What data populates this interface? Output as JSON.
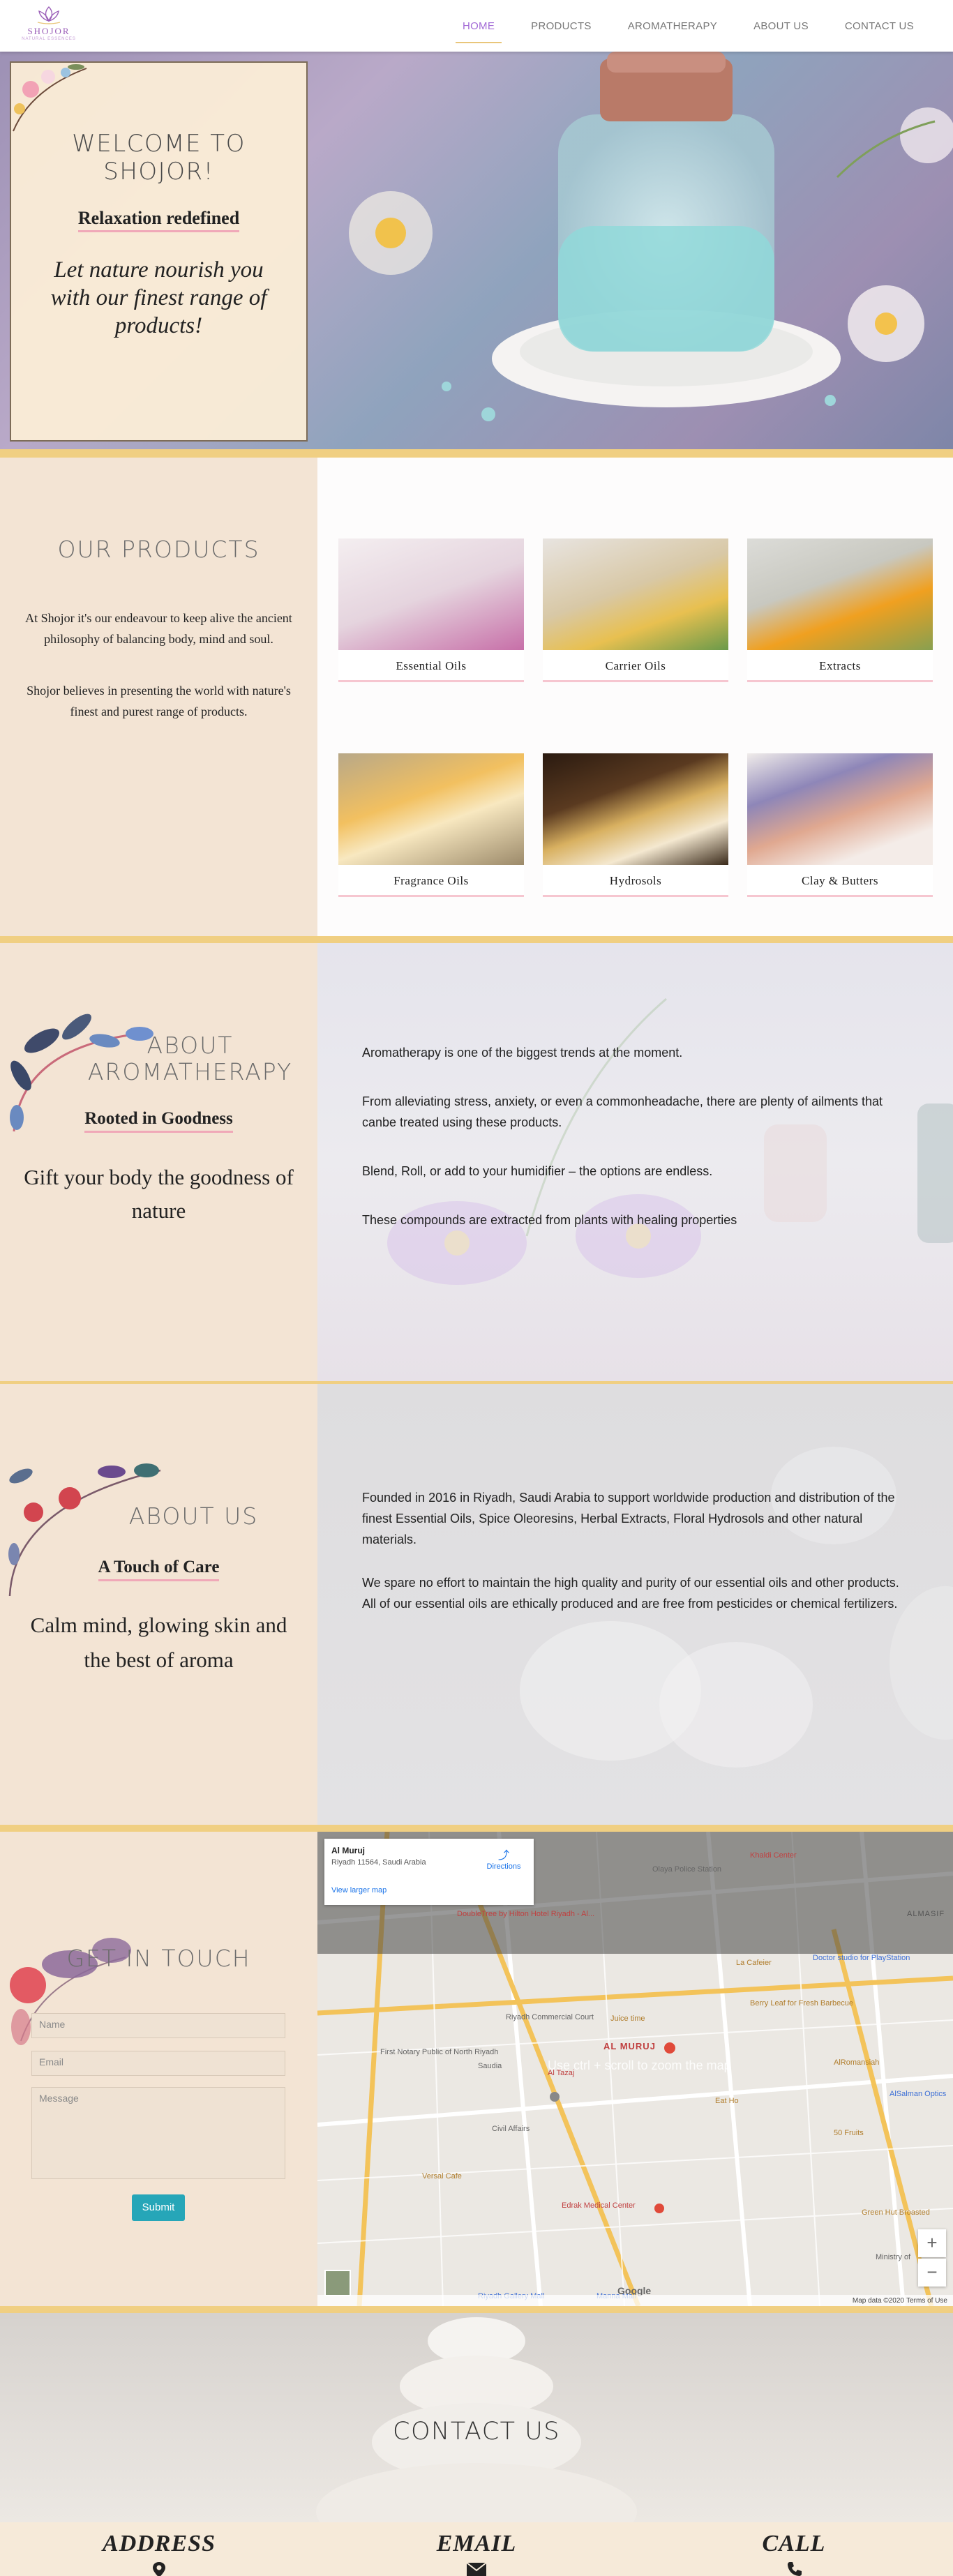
{
  "brand": {
    "name": "SHOJOR",
    "tagline": "NATURAL ESSENCES"
  },
  "nav": {
    "items": [
      "HOME",
      "PRODUCTS",
      "AROMATHERAPY",
      "ABOUT US",
      "CONTACT US"
    ],
    "active": "HOME"
  },
  "hero": {
    "title_line1": "WELCOME TO",
    "title_line2": "SHOJOR!",
    "subtitle": "Relaxation redefined",
    "text": "Let nature nourish you with our finest range of products!"
  },
  "products": {
    "title": "OUR PRODUCTS",
    "para1": "At Shojor it's our endeavour to keep alive the ancient philosophy of balancing body, mind and soul.",
    "para2": "Shojor believes in presenting the world with nature's finest and purest range of products.",
    "items": [
      {
        "label": "Essential Oils"
      },
      {
        "label": "Carrier Oils"
      },
      {
        "label": "Extracts"
      },
      {
        "label": "Fragrance Oils"
      },
      {
        "label": "Hydrosols"
      },
      {
        "label": "Clay & Butters"
      }
    ]
  },
  "aromatherapy": {
    "title_line1": "ABOUT",
    "title_line2": "AROMATHERAPY",
    "subtitle": "Rooted in Goodness",
    "tagline": "Gift your body the goodness of nature",
    "paragraphs": [
      "Aromatherapy is one of the biggest trends at the moment.",
      "From alleviating stress, anxiety, or even a commonheadache, there are plenty of ailments that canbe treated using these products.",
      "Blend, Roll, or add to your humidifier – the options are endless.",
      "These compounds are extracted from plants with healing properties"
    ]
  },
  "about": {
    "title": "ABOUT US",
    "subtitle": "A Touch of Care",
    "tagline": "Calm mind, glowing skin and the best of aroma",
    "paragraphs": [
      "Founded in 2016 in Riyadh, Saudi Arabia to support worldwide production and distribution of the finest Essential Oils, Spice Oleoresins, Herbal Extracts, Floral Hydrosols and other natural materials.",
      "We spare no effort to maintain the high quality and purity of our essential oils and other products. All of our essential oils are ethically produced and are free from pesticides or chemical fertilizers."
    ]
  },
  "contact_form": {
    "title": "GET IN TOUCH",
    "name_placeholder": "Name",
    "email_placeholder": "Email",
    "message_placeholder": "Message",
    "submit": "Submit"
  },
  "map": {
    "place": "Al Muruj",
    "address": "Riyadh 11564, Saudi Arabia",
    "directions": "Directions",
    "larger_map": "View larger map",
    "scroll_hint": "Use ctrl + scroll to zoom the map",
    "district": "AL MURUJ",
    "district2": "ALMASIF",
    "zoom_in": "+",
    "zoom_out": "−",
    "attribution": "Map data ©2020",
    "terms": "Terms of Use",
    "google": "Google",
    "pois": [
      "Olaya Police Station",
      "DoubleTree by Hilton Hotel Riyadh - Al...",
      "Khaldi Center",
      "Doctor studio for PlayStation",
      "La Cafeier",
      "Berry Leaf for Fresh Barbecue",
      "Riyadh Commercial Court",
      "First Notary Public of North Riyadh",
      "Saudia",
      "Al Tazaj",
      "Juice time",
      "AlRomansiah",
      "Civil Affairs",
      "Versal Cafe",
      "Edrak Medical Center",
      "50 Fruits",
      "Green Hut Broasted",
      "Ministry of",
      "AlSalman Optics",
      "Riyadh Gallery Mall",
      "Manna Mall",
      "Eat Ho"
    ]
  },
  "contact_banner": {
    "title": "CONTACT US"
  },
  "footer": {
    "address": "ADDRESS",
    "email": "EMAIL",
    "call": "CALL"
  },
  "colors": {
    "accent": "#a36bd6",
    "gold": "#f0cf82",
    "pink_underline": "#f0a8b8",
    "panel": "#f3e4d4",
    "teal_button": "#26a6b8"
  }
}
